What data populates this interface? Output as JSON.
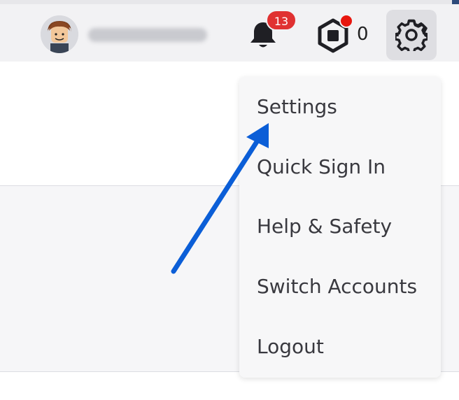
{
  "header": {
    "notifications": {
      "count": "13"
    },
    "robux": {
      "count": "0",
      "has_alert": true
    }
  },
  "menu": {
    "items": [
      {
        "label": "Settings"
      },
      {
        "label": "Quick Sign In"
      },
      {
        "label": "Help & Safety"
      },
      {
        "label": "Switch Accounts"
      },
      {
        "label": "Logout"
      }
    ]
  },
  "colors": {
    "badge": "#e03131",
    "arrow": "#0b5ed7",
    "menu_background": "#f7f7f8",
    "topbar_background": "#f2f2f4"
  },
  "icons": [
    "avatar",
    "bell-icon",
    "robux-icon",
    "gear-icon",
    "arrow-annotation"
  ]
}
